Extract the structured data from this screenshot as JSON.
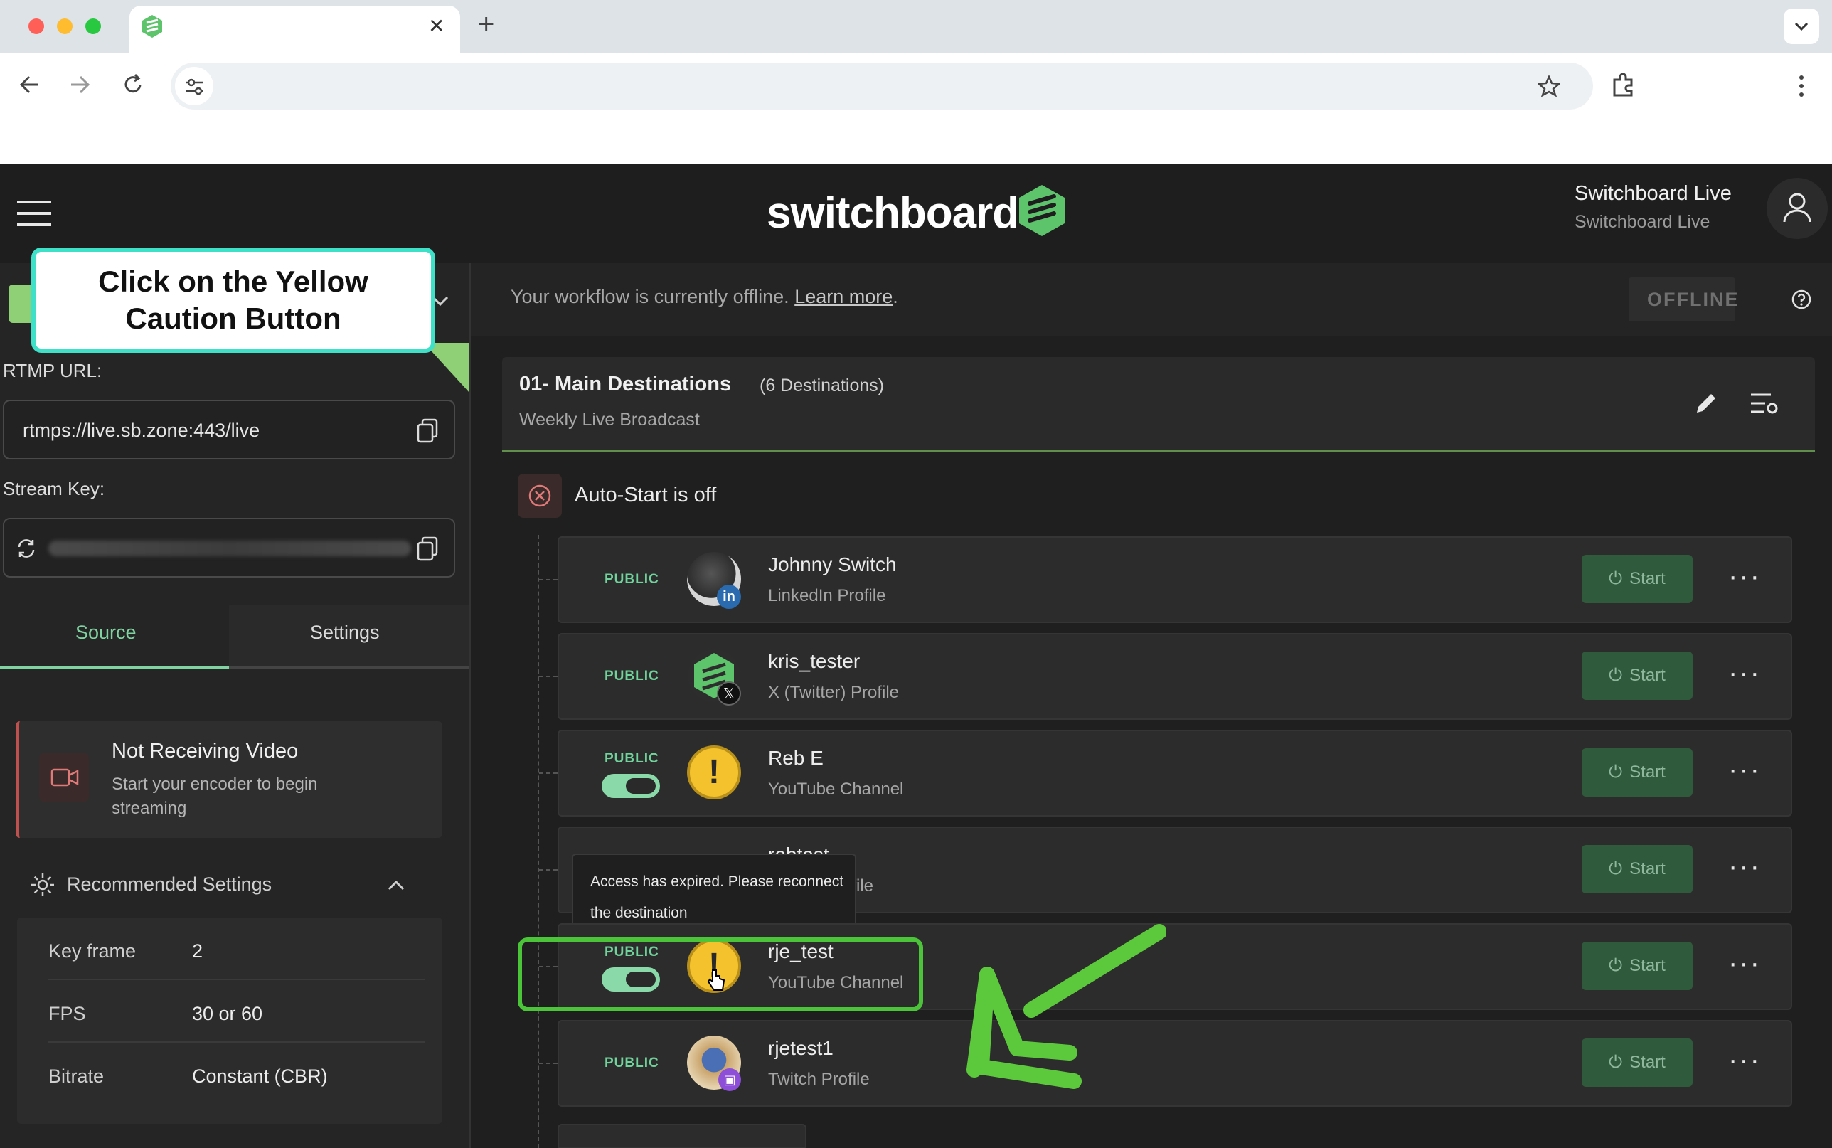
{
  "browser": {
    "tab_close": "✕",
    "new_tab": "+"
  },
  "header": {
    "brand": "switchboard",
    "account_name": "Switchboard Live",
    "account_sub": "Switchboard Live"
  },
  "callout": {
    "text": "Click on the Yellow Caution Button"
  },
  "sidebar": {
    "rtmp_label": "RTMP URL:",
    "rtmp_value": "rtmps://live.sb.zone:443/live",
    "stream_key_label": "Stream Key:",
    "tabs": [
      {
        "label": "Source",
        "active": true
      },
      {
        "label": "Settings",
        "active": false
      }
    ],
    "status": {
      "title": "Not Receiving Video",
      "desc": "Start your encoder to begin streaming"
    },
    "recommended": {
      "title": "Recommended Settings",
      "rows": [
        {
          "key": "Key frame",
          "value": "2"
        },
        {
          "key": "FPS",
          "value": "30 or 60"
        },
        {
          "key": "Bitrate",
          "value": "Constant (CBR)"
        }
      ]
    }
  },
  "main": {
    "offline_text": "Your workflow is currently offline.",
    "learn_more": "Learn more",
    "offline_period": ".",
    "status_badge": "OFFLINE",
    "group": {
      "title": "01- Main Destinations",
      "count": "(6 Destinations)",
      "subtitle": "Weekly Live Broadcast"
    },
    "autostart": "Auto-Start is off",
    "tooltip": "Access has expired. Please reconnect the destination",
    "start_label": "Start",
    "destinations": [
      {
        "visibility": "PUBLIC",
        "name": "Johnny Switch",
        "sub": "LinkedIn Profile",
        "platform": "linkedin",
        "toggle": false,
        "warning": false
      },
      {
        "visibility": "PUBLIC",
        "name": "kris_tester",
        "sub": "X (Twitter) Profile",
        "platform": "x",
        "toggle": false,
        "warning": false
      },
      {
        "visibility": "PUBLIC",
        "name": "Reb E",
        "sub": "YouTube Channel",
        "platform": "youtube",
        "toggle": true,
        "warning": true
      },
      {
        "visibility": "",
        "name": "rebtest",
        "sub": "ofile",
        "platform": "",
        "toggle": false,
        "warning": false
      },
      {
        "visibility": "PUBLIC",
        "name": "rje_test",
        "sub": "YouTube Channel",
        "platform": "youtube",
        "toggle": true,
        "warning": true
      },
      {
        "visibility": "PUBLIC",
        "name": "rjetest1",
        "sub": "Twitch Profile",
        "platform": "twitch",
        "toggle": false,
        "warning": false
      }
    ]
  },
  "colors": {
    "accent_green": "#6fd39b",
    "highlight_green": "#4cc43a",
    "warning_yellow": "#f3c22c",
    "callout_border": "#3ee0c8"
  }
}
